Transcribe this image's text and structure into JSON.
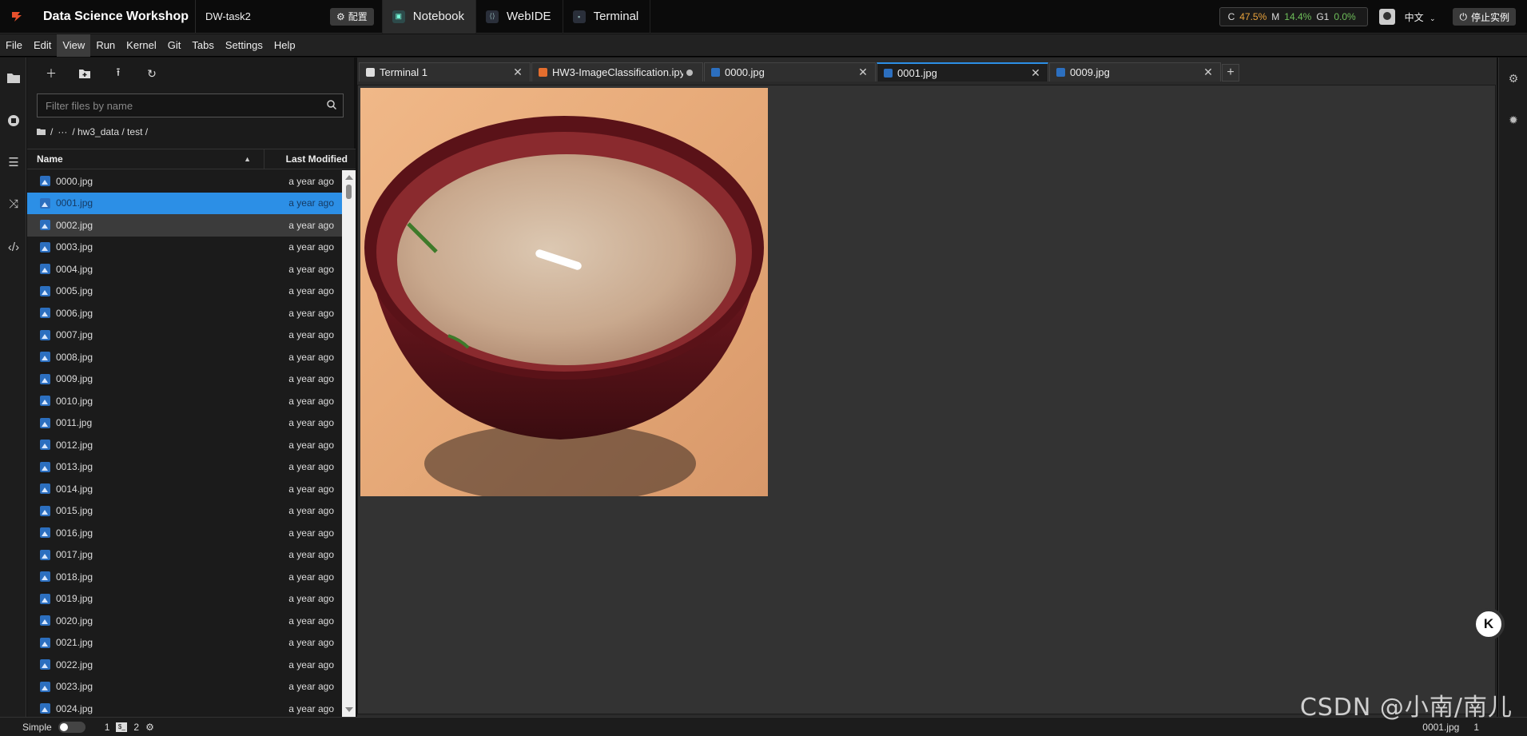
{
  "topbar": {
    "app_title": "Data Science Workshop",
    "project_name": "DW-task2",
    "config_label": "配置",
    "modes": [
      {
        "label": "Notebook",
        "active": true
      },
      {
        "label": "WebIDE",
        "active": false
      },
      {
        "label": "Terminal",
        "active": false
      }
    ],
    "resources": {
      "c_label": "C",
      "c_value": "47.5%",
      "m_label": "M",
      "m_value": "14.4%",
      "g_label": "G1",
      "g_value": "0.0%"
    },
    "language": "中文",
    "stop_label": "停止实例"
  },
  "menu": [
    "File",
    "Edit",
    "View",
    "Run",
    "Kernel",
    "Git",
    "Tabs",
    "Settings",
    "Help"
  ],
  "menu_active": "View",
  "filebrowser": {
    "search_placeholder": "Filter files by name",
    "crumbs": [
      "/",
      "···",
      "/ hw3_data / test /"
    ],
    "col_name": "Name",
    "col_modified": "Last Modified",
    "files": [
      {
        "name": "0000.jpg",
        "modified": "a year ago"
      },
      {
        "name": "0001.jpg",
        "modified": "a year ago"
      },
      {
        "name": "0002.jpg",
        "modified": "a year ago"
      },
      {
        "name": "0003.jpg",
        "modified": "a year ago"
      },
      {
        "name": "0004.jpg",
        "modified": "a year ago"
      },
      {
        "name": "0005.jpg",
        "modified": "a year ago"
      },
      {
        "name": "0006.jpg",
        "modified": "a year ago"
      },
      {
        "name": "0007.jpg",
        "modified": "a year ago"
      },
      {
        "name": "0008.jpg",
        "modified": "a year ago"
      },
      {
        "name": "0009.jpg",
        "modified": "a year ago"
      },
      {
        "name": "0010.jpg",
        "modified": "a year ago"
      },
      {
        "name": "0011.jpg",
        "modified": "a year ago"
      },
      {
        "name": "0012.jpg",
        "modified": "a year ago"
      },
      {
        "name": "0013.jpg",
        "modified": "a year ago"
      },
      {
        "name": "0014.jpg",
        "modified": "a year ago"
      },
      {
        "name": "0015.jpg",
        "modified": "a year ago"
      },
      {
        "name": "0016.jpg",
        "modified": "a year ago"
      },
      {
        "name": "0017.jpg",
        "modified": "a year ago"
      },
      {
        "name": "0018.jpg",
        "modified": "a year ago"
      },
      {
        "name": "0019.jpg",
        "modified": "a year ago"
      },
      {
        "name": "0020.jpg",
        "modified": "a year ago"
      },
      {
        "name": "0021.jpg",
        "modified": "a year ago"
      },
      {
        "name": "0022.jpg",
        "modified": "a year ago"
      },
      {
        "name": "0023.jpg",
        "modified": "a year ago"
      },
      {
        "name": "0024.jpg",
        "modified": "a year ago"
      }
    ],
    "selected": "0001.jpg",
    "hovered": "0002.jpg"
  },
  "tabs": [
    {
      "label": "Terminal 1",
      "icon": "terminal-icon",
      "active": false,
      "dirty": false
    },
    {
      "label": "HW3-ImageClassification.ipy",
      "icon": "notebook-icon",
      "active": false,
      "dirty": true
    },
    {
      "label": "0000.jpg",
      "icon": "image-icon",
      "active": false,
      "dirty": false
    },
    {
      "label": "0001.jpg",
      "icon": "image-icon",
      "active": true,
      "dirty": false
    },
    {
      "label": "0009.jpg",
      "icon": "image-icon",
      "active": false,
      "dirty": false
    }
  ],
  "statusbar": {
    "simple_label": "Simple",
    "kernels": "1",
    "terminals": "2",
    "current_file": "0001.jpg",
    "right_count": "1"
  },
  "watermark": "CSDN @小南/南儿",
  "colors": {
    "accent": "#2c8fe6",
    "cpu": "#e8a23c",
    "mem_gpu": "#6fbf5a"
  }
}
